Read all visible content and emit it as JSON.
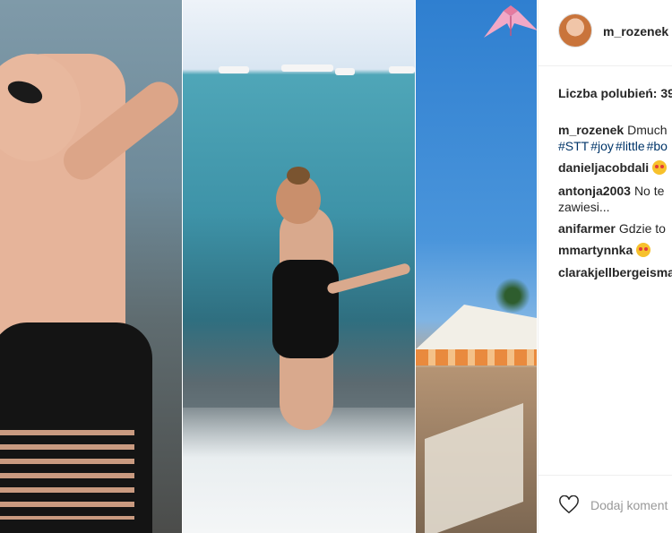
{
  "post": {
    "username": "m_rozenek",
    "likes_text": "Liczba polubień: 39",
    "caption": {
      "user": "m_rozenek",
      "text": "Dmuch",
      "hashtags": [
        "#STT",
        "#joy",
        "#little",
        "#bo"
      ]
    },
    "comments": [
      {
        "user": "danieljacobdali",
        "text": "",
        "emoji": "heart-eyes-emoji"
      },
      {
        "user": "antonja2003",
        "text": "No te",
        "text2": "zawiesi..."
      },
      {
        "user": "anifarmer",
        "text": "Gdzie to"
      },
      {
        "user": "mmartynnka",
        "text": "",
        "emoji": "kiss-emoji"
      },
      {
        "user": "clarakjellbergeisma",
        "text": ""
      }
    ],
    "add_comment_placeholder": "Dodaj koment"
  },
  "icons": {
    "like": "heart-icon",
    "avatar": "avatar"
  },
  "colors": {
    "hashtag": "#003569",
    "text": "#262626",
    "muted": "#999999",
    "divider": "#efefef"
  }
}
